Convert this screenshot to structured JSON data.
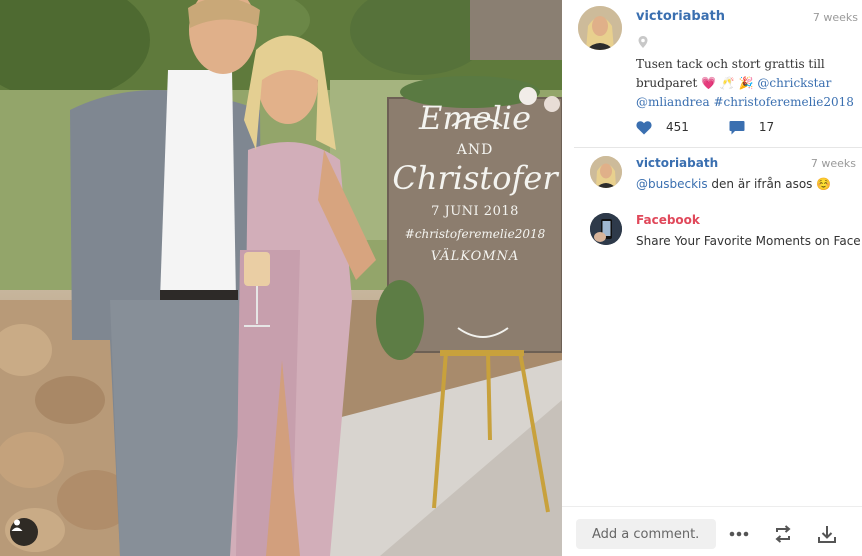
{
  "post": {
    "username": "victoriabath",
    "time_ago": "7 weeks",
    "caption_text": "Tusen tack och stort grattis till brudparet 💗 🥂 🎉",
    "caption_mention_1": "@chrickstar",
    "caption_mention_2": "@mliandrea",
    "caption_hashtag": "#christoferemelie2018",
    "likes": "451",
    "comments_count": "17"
  },
  "sign": {
    "name_1": "Emelie",
    "and": "AND",
    "name_2": "Christofer",
    "date": "7 JUNI 2018",
    "hashtag": "#christoferemelie2018",
    "welcome": "VÄLKOMNA"
  },
  "comments": [
    {
      "username": "victoriabath",
      "time_ago": "7 weeks",
      "mention": "@busbeckis",
      "text": " den är ifrån asos ☺️"
    },
    {
      "username": "Facebook",
      "text": "Share Your Favorite Moments on Face…"
    }
  ],
  "bottom_bar": {
    "comment_placeholder": "Add a comment..."
  },
  "icons": {
    "location": "location-pin-icon",
    "like": "heart-icon",
    "comment": "comment-bubble-icon",
    "more": "more-dots-icon",
    "repost": "repost-icon",
    "download": "download-icon",
    "tag": "user-tag-icon"
  },
  "colors": {
    "link_blue": "#3a6fb0",
    "facebook_red": "#e0485a",
    "like_blue": "#3a6fb0"
  }
}
